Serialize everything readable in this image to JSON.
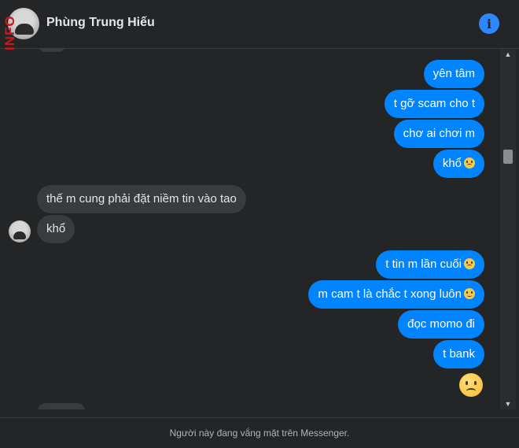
{
  "header": {
    "watermark": "INFO",
    "contact_name": "Phùng Trung Hiếu",
    "info_symbol": "i"
  },
  "messages": {
    "out1": "yên tâm",
    "out2": "t gỡ scam cho t",
    "out3": "chơ ai chơi m",
    "out4": "khổ",
    "in1": "thế m cung phải đặt niềm tin vào tao",
    "in2": "khổ",
    "out5": "t tin m lần cuối",
    "out6": "m cam t là chắc t xong luôn",
    "out7": "đọc momo đi",
    "out8": "t bank"
  },
  "emojis": {
    "out4": "sad-face",
    "out5": "sad-face",
    "out6": "smile-face",
    "final": "sad-face"
  },
  "footer": {
    "status_text": "Người này đang vắng mặt trên Messenger."
  },
  "colors": {
    "outgoing_bubble": "#0084ff",
    "incoming_bubble": "#3a3b3c",
    "background": "#242526",
    "info_icon": "#2d88ff"
  }
}
